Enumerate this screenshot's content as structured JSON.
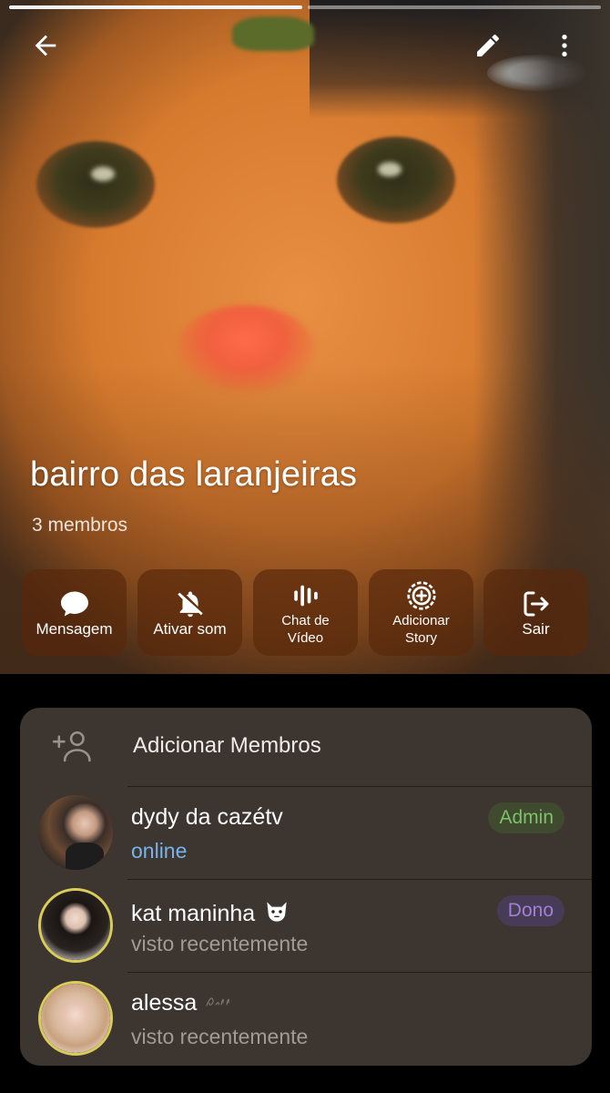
{
  "group": {
    "title": "bairro das laranjeiras",
    "members_count": "3 membros"
  },
  "actions": [
    {
      "label": "Mensagem",
      "icon": "message-icon"
    },
    {
      "label": "Ativar som",
      "icon": "bell-off-icon"
    },
    {
      "label": "Chat de\nVídeo",
      "icon": "voice-chat-icon"
    },
    {
      "label": "Adicionar\nStory",
      "icon": "add-story-icon"
    },
    {
      "label": "Sair",
      "icon": "exit-icon"
    }
  ],
  "panel": {
    "add_members_label": "Adicionar Membros",
    "members": [
      {
        "name": "dydy da cazétv",
        "status": "online",
        "badge": "Admin"
      },
      {
        "name": "kat maninha",
        "status": "visto recentemente",
        "badge": "Dono"
      },
      {
        "name": "alessa",
        "status": "visto recentemente",
        "badge": ""
      }
    ]
  },
  "colors": {
    "admin_badge": "#7fc06a",
    "owner_badge": "#a37fd4",
    "online_status": "#78b3ea",
    "panel_bg": "#3d3530"
  }
}
